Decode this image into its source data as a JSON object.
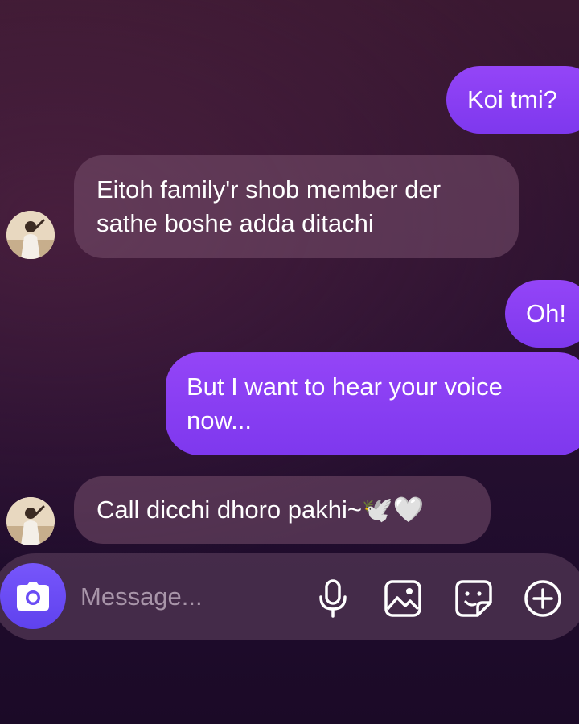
{
  "messages": [
    {
      "id": "m1",
      "direction": "outgoing",
      "text": "Koi tmi?"
    },
    {
      "id": "m2",
      "direction": "incoming",
      "line1": "Eitoh family'r shob member der",
      "line2": "sathe boshe adda ditachi"
    },
    {
      "id": "m3",
      "direction": "outgoing",
      "text": "Oh!"
    },
    {
      "id": "m4",
      "direction": "outgoing",
      "line1": "But I want to hear your voice",
      "line2": "now..."
    },
    {
      "id": "m5",
      "direction": "incoming",
      "text": "Call dicchi dhoro pakhi~🕊️🤍"
    }
  ],
  "composer": {
    "placeholder": "Message...",
    "icons": [
      "camera-icon",
      "microphone-icon",
      "gallery-icon",
      "sticker-icon",
      "plus-icon"
    ]
  },
  "colors": {
    "outgoing_bubble": "#8a3cf3",
    "incoming_bubble": "#5a3a55",
    "camera_button": "#6a4cf5",
    "background_top": "#3a1831",
    "background_bottom": "#1b0a27"
  }
}
